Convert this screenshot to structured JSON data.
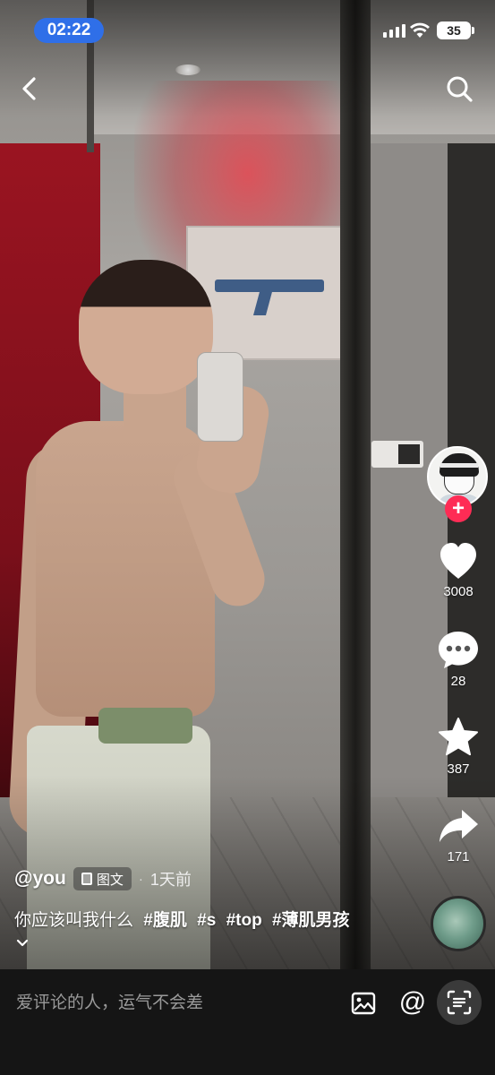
{
  "status_bar": {
    "time": "02:22",
    "battery": "35"
  },
  "nav": {
    "back_icon": "chevron-left-icon",
    "search_icon": "search-icon"
  },
  "actions": {
    "likes": "3008",
    "comments": "28",
    "favorites": "387",
    "shares": "171",
    "follow_label": "+"
  },
  "post": {
    "author": "@you",
    "type_label": "图文",
    "separator": "·",
    "time_ago": "1天前",
    "caption_text": "你应该叫我什么",
    "hashtags": [
      "#腹肌",
      "#s",
      "#top",
      "#薄肌男孩"
    ]
  },
  "comment_bar": {
    "placeholder": "爱评论的人，运气不会差",
    "at_symbol": "@"
  },
  "colors": {
    "accent": "#fe2c55",
    "time_pill": "#2f6fe8",
    "bar_bg": "#151515"
  }
}
